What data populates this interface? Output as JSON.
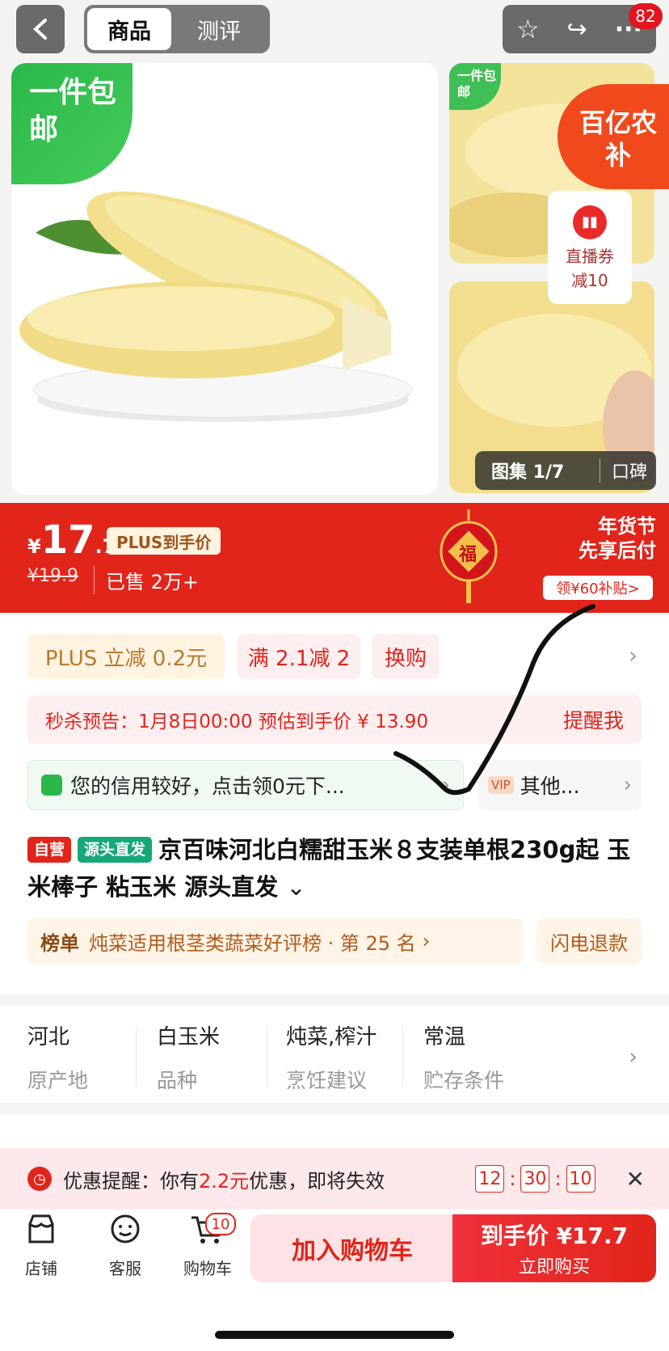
{
  "header": {
    "tabs": [
      "商品",
      "测评"
    ],
    "notification_count": "82"
  },
  "gallery": {
    "free_shipping": "一件包邮",
    "free_shipping_small": "一件包邮",
    "baiyi_badge": "百亿农补",
    "live_coupon": {
      "line1": "直播券",
      "line2": "减10"
    },
    "album_label": "图集 1/7",
    "reviews_tab": "口碑"
  },
  "price": {
    "currency": "¥",
    "main": "17",
    "decimal": ".7",
    "plus_tag": "PLUS到手价",
    "original": "¥19.9",
    "sold": "已售 2万+",
    "festival_title": "年货节",
    "festival_sub": "先享后付",
    "subsidy_coupon": "领¥60补贴>",
    "lantern_char": "福"
  },
  "promos": {
    "chips": [
      "PLUS 立减 0.2元",
      "满 2.1减 2",
      "换购"
    ],
    "seckill": "秒杀预告：1月8日00:00 预估到手价 ¥ 13.90",
    "seckill_action": "提醒我",
    "credit": "您的信用较好，点击领0元下...",
    "vip_label": "VIP",
    "vip_text": "其他..."
  },
  "product": {
    "tag_self": "自营",
    "tag_source": "源头直发",
    "title": "京百味河北白糯甜玉米８支装单根230g起 玉米棒子 粘玉米 源头直发",
    "rank_label": "榜单",
    "rank_text": "炖菜适用根茎类蔬菜好评榜 · 第 25 名",
    "refund": "闪电退款"
  },
  "attributes": [
    {
      "value": "河北",
      "key": "原产地"
    },
    {
      "value": "白玉米",
      "key": "品种"
    },
    {
      "value": "炖菜,榨汁",
      "key": "烹饪建议"
    },
    {
      "value": "常温",
      "key": "贮存条件"
    }
  ],
  "reminder": {
    "prefix": "优惠提醒：你有",
    "amount": "2.2元",
    "suffix": "优惠，即将失效",
    "timer": [
      "12",
      "30",
      "10"
    ]
  },
  "bottom_nav": {
    "shop": "店铺",
    "service": "客服",
    "cart": "购物车",
    "cart_count": "10",
    "add_to_cart": "加入购物车",
    "buy_price": "到手价 ¥17.7",
    "buy_now": "立即购买"
  },
  "colors": {
    "brand_red": "#e1251b",
    "green": "#2bb84a"
  }
}
